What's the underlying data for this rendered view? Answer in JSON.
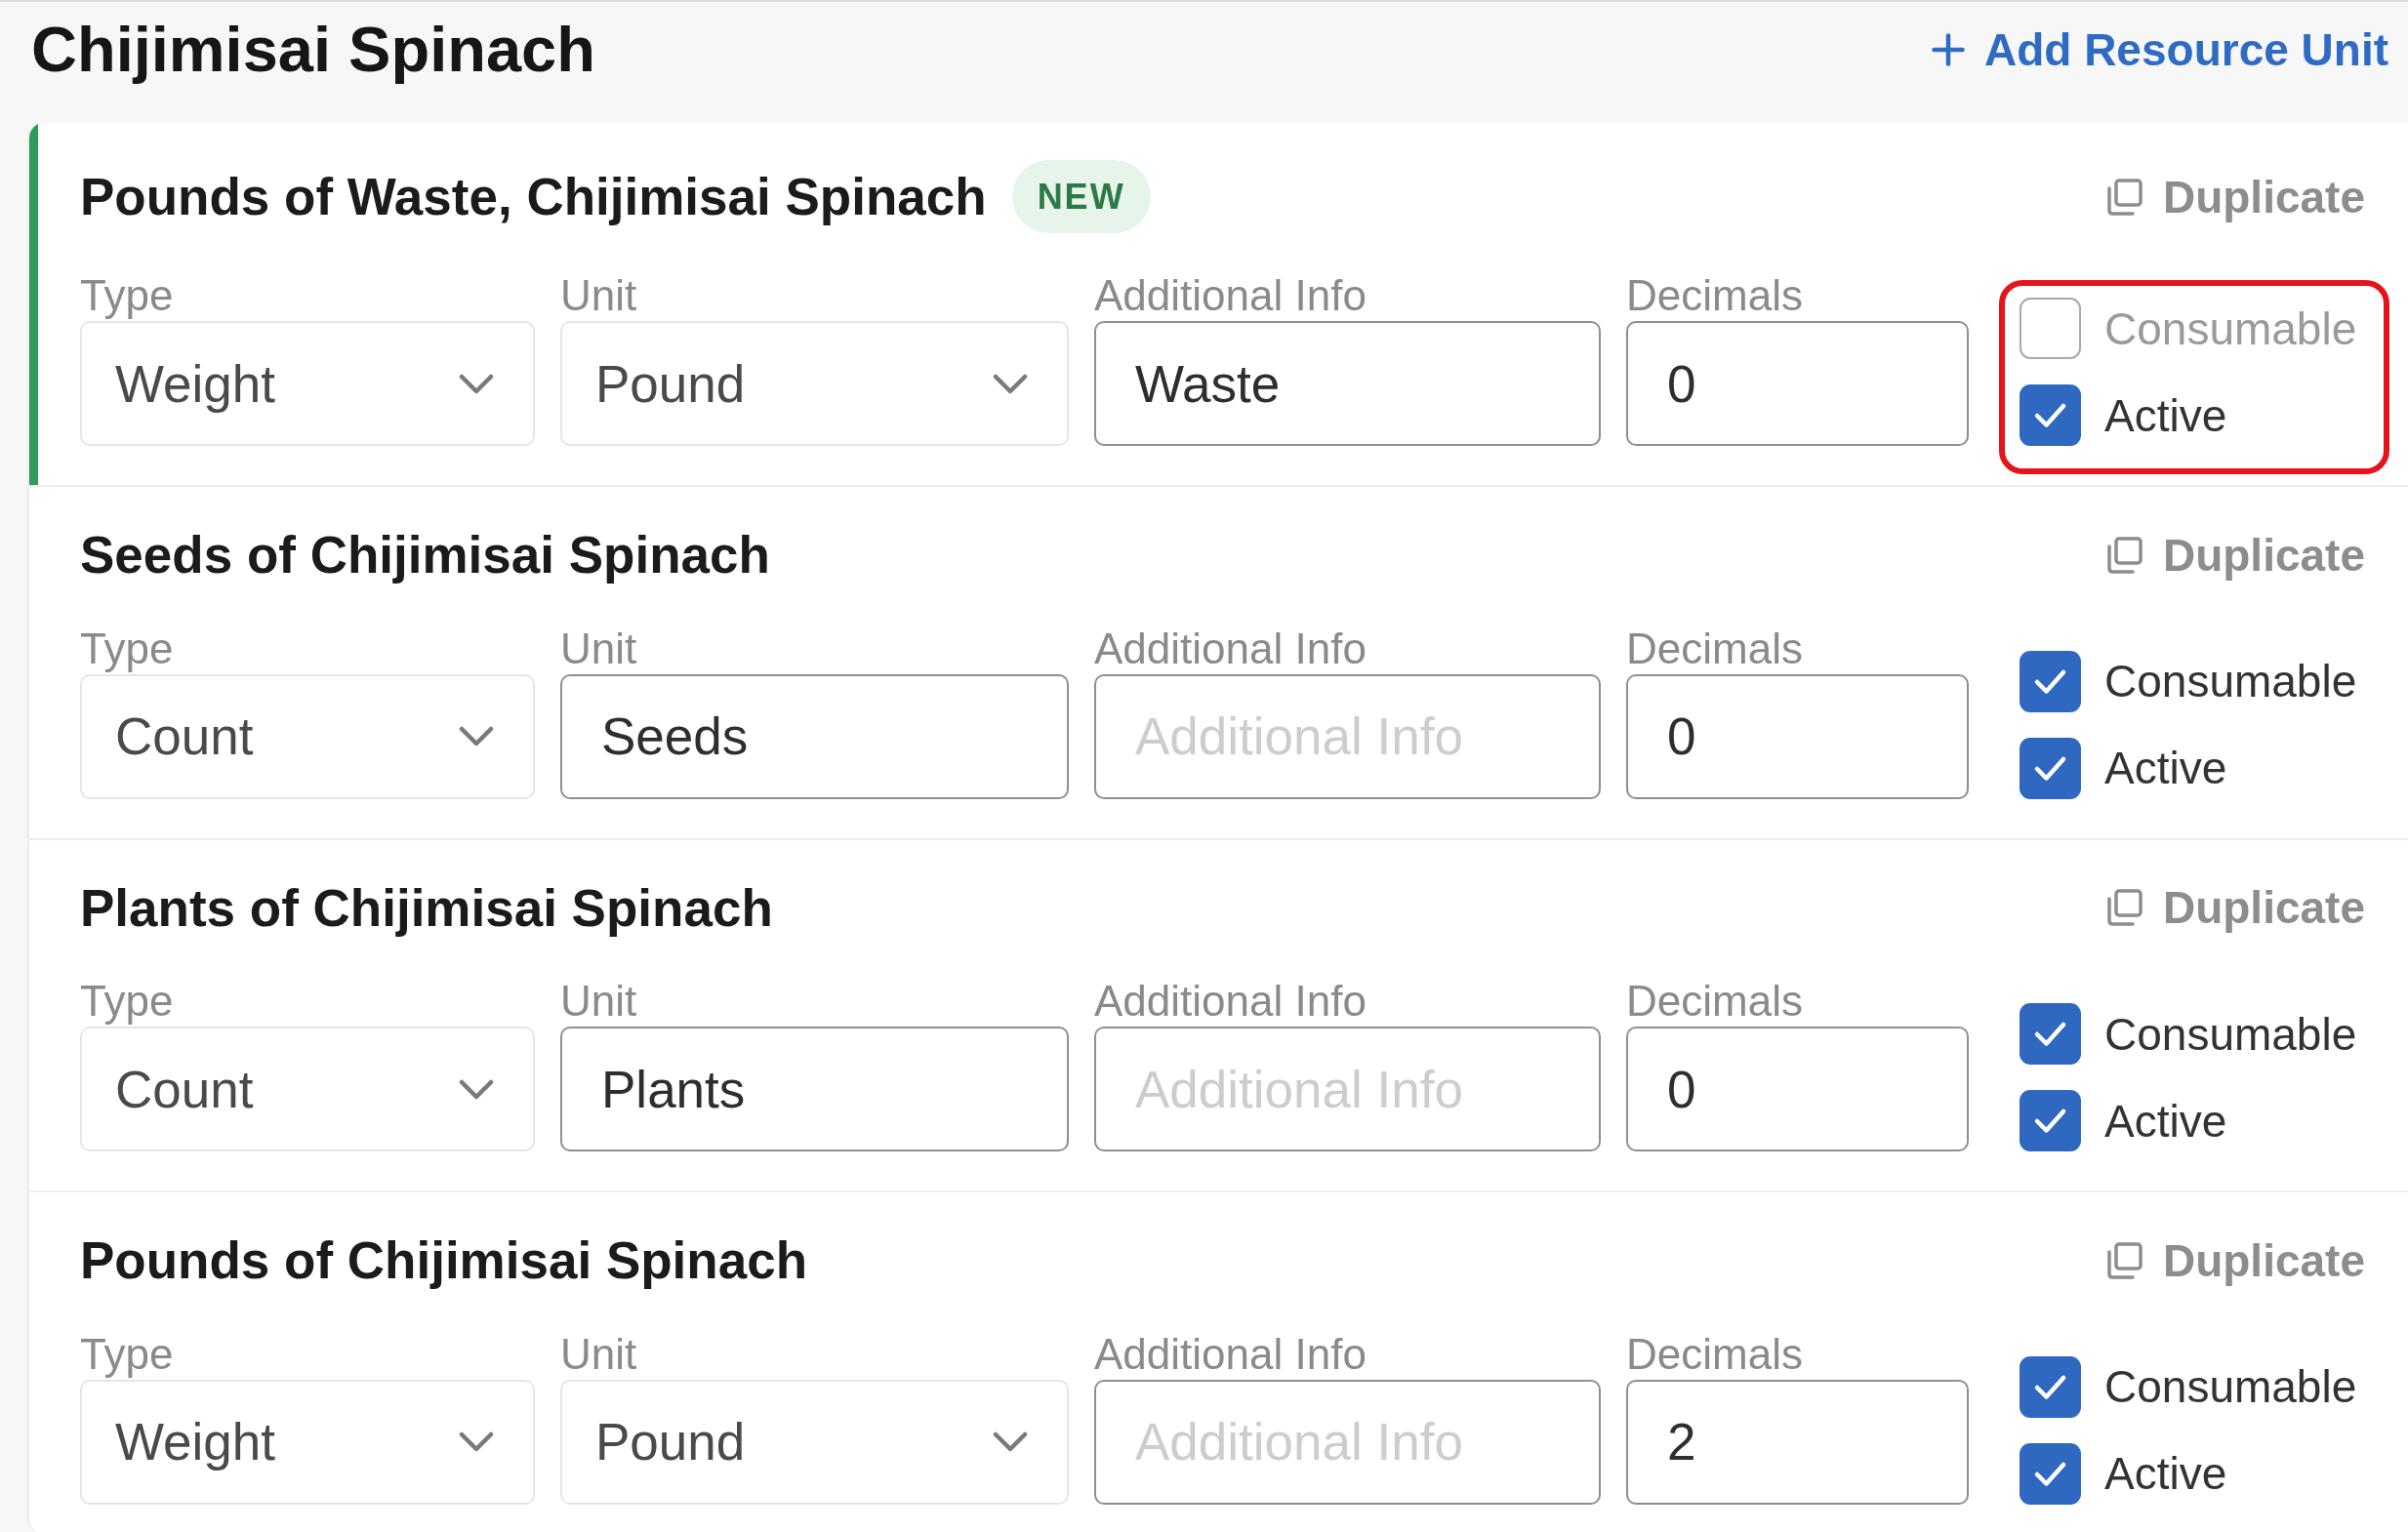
{
  "header": {
    "title": "Chijimisai Spinach",
    "add_button": "Add Resource Unit"
  },
  "units": [
    {
      "title": "Pounds of Waste, Chijimisai Spinach",
      "badge": "NEW",
      "is_new": true,
      "duplicate": "Duplicate",
      "fields": [
        {
          "kind": "select",
          "label": "Type",
          "value": "Weight"
        },
        {
          "kind": "select",
          "label": "Unit",
          "value": "Pound"
        },
        {
          "kind": "input",
          "label": "Additional Info",
          "value": "Waste"
        },
        {
          "kind": "input",
          "label": "Decimals",
          "value": "0"
        }
      ],
      "checkboxes": [
        {
          "label": "Consumable",
          "checked": false
        },
        {
          "label": "Active",
          "checked": true
        }
      ],
      "highlighted": true
    },
    {
      "title": "Seeds of Chijimisai Spinach",
      "is_new": false,
      "duplicate": "Duplicate",
      "fields": [
        {
          "kind": "select",
          "label": "Type",
          "value": "Count"
        },
        {
          "kind": "input",
          "label": "Unit",
          "value": "Seeds"
        },
        {
          "kind": "input",
          "label": "Additional Info",
          "placeholder": "Additional Info"
        },
        {
          "kind": "input",
          "label": "Decimals",
          "value": "0"
        }
      ],
      "checkboxes": [
        {
          "label": "Consumable",
          "checked": true
        },
        {
          "label": "Active",
          "checked": true
        }
      ],
      "highlighted": false
    },
    {
      "title": "Plants of Chijimisai Spinach",
      "is_new": false,
      "duplicate": "Duplicate",
      "fields": [
        {
          "kind": "select",
          "label": "Type",
          "value": "Count"
        },
        {
          "kind": "input",
          "label": "Unit",
          "value": "Plants"
        },
        {
          "kind": "input",
          "label": "Additional Info",
          "placeholder": "Additional Info"
        },
        {
          "kind": "input",
          "label": "Decimals",
          "value": "0"
        }
      ],
      "checkboxes": [
        {
          "label": "Consumable",
          "checked": true
        },
        {
          "label": "Active",
          "checked": true
        }
      ],
      "highlighted": false
    },
    {
      "title": "Pounds of Chijimisai Spinach",
      "is_new": false,
      "duplicate": "Duplicate",
      "fields": [
        {
          "kind": "select",
          "label": "Type",
          "value": "Weight"
        },
        {
          "kind": "select",
          "label": "Unit",
          "value": "Pound"
        },
        {
          "kind": "input",
          "label": "Additional Info",
          "placeholder": "Additional Info"
        },
        {
          "kind": "input",
          "label": "Decimals",
          "value": "2"
        }
      ],
      "checkboxes": [
        {
          "label": "Consumable",
          "checked": true
        },
        {
          "label": "Active",
          "checked": true
        }
      ],
      "highlighted": false
    }
  ]
}
